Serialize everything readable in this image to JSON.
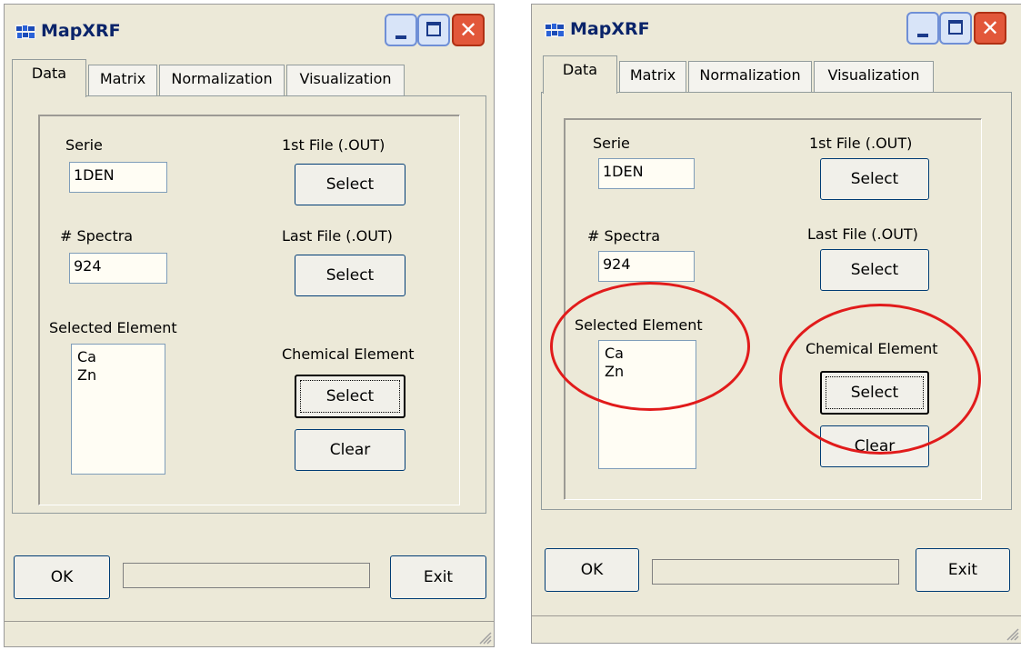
{
  "window": {
    "title": "MapXRF",
    "close_glyph": "✕"
  },
  "tabs": [
    "Data",
    "Matrix",
    "Normalization",
    "Visualization"
  ],
  "fields": {
    "serie_label": "Serie",
    "serie_value": "1DEN",
    "spectra_label": "# Spectra",
    "spectra_value": "924",
    "selected_element_label": "Selected Element",
    "selected_elements": [
      "Ca",
      "Zn"
    ],
    "first_file_label": "1st File (.OUT)",
    "last_file_label": "Last File (.OUT)",
    "chemical_element_label": "Chemical Element"
  },
  "buttons": {
    "select": "Select",
    "clear": "Clear",
    "ok": "OK",
    "exit": "Exit"
  },
  "annotations": {
    "color": "#e11b1b",
    "circled_items": [
      "Selected Element",
      "Chemical Element"
    ]
  },
  "icons": [
    "app-icon",
    "minimize-icon",
    "maximize-icon",
    "close-icon",
    "resize-grip-icon"
  ]
}
